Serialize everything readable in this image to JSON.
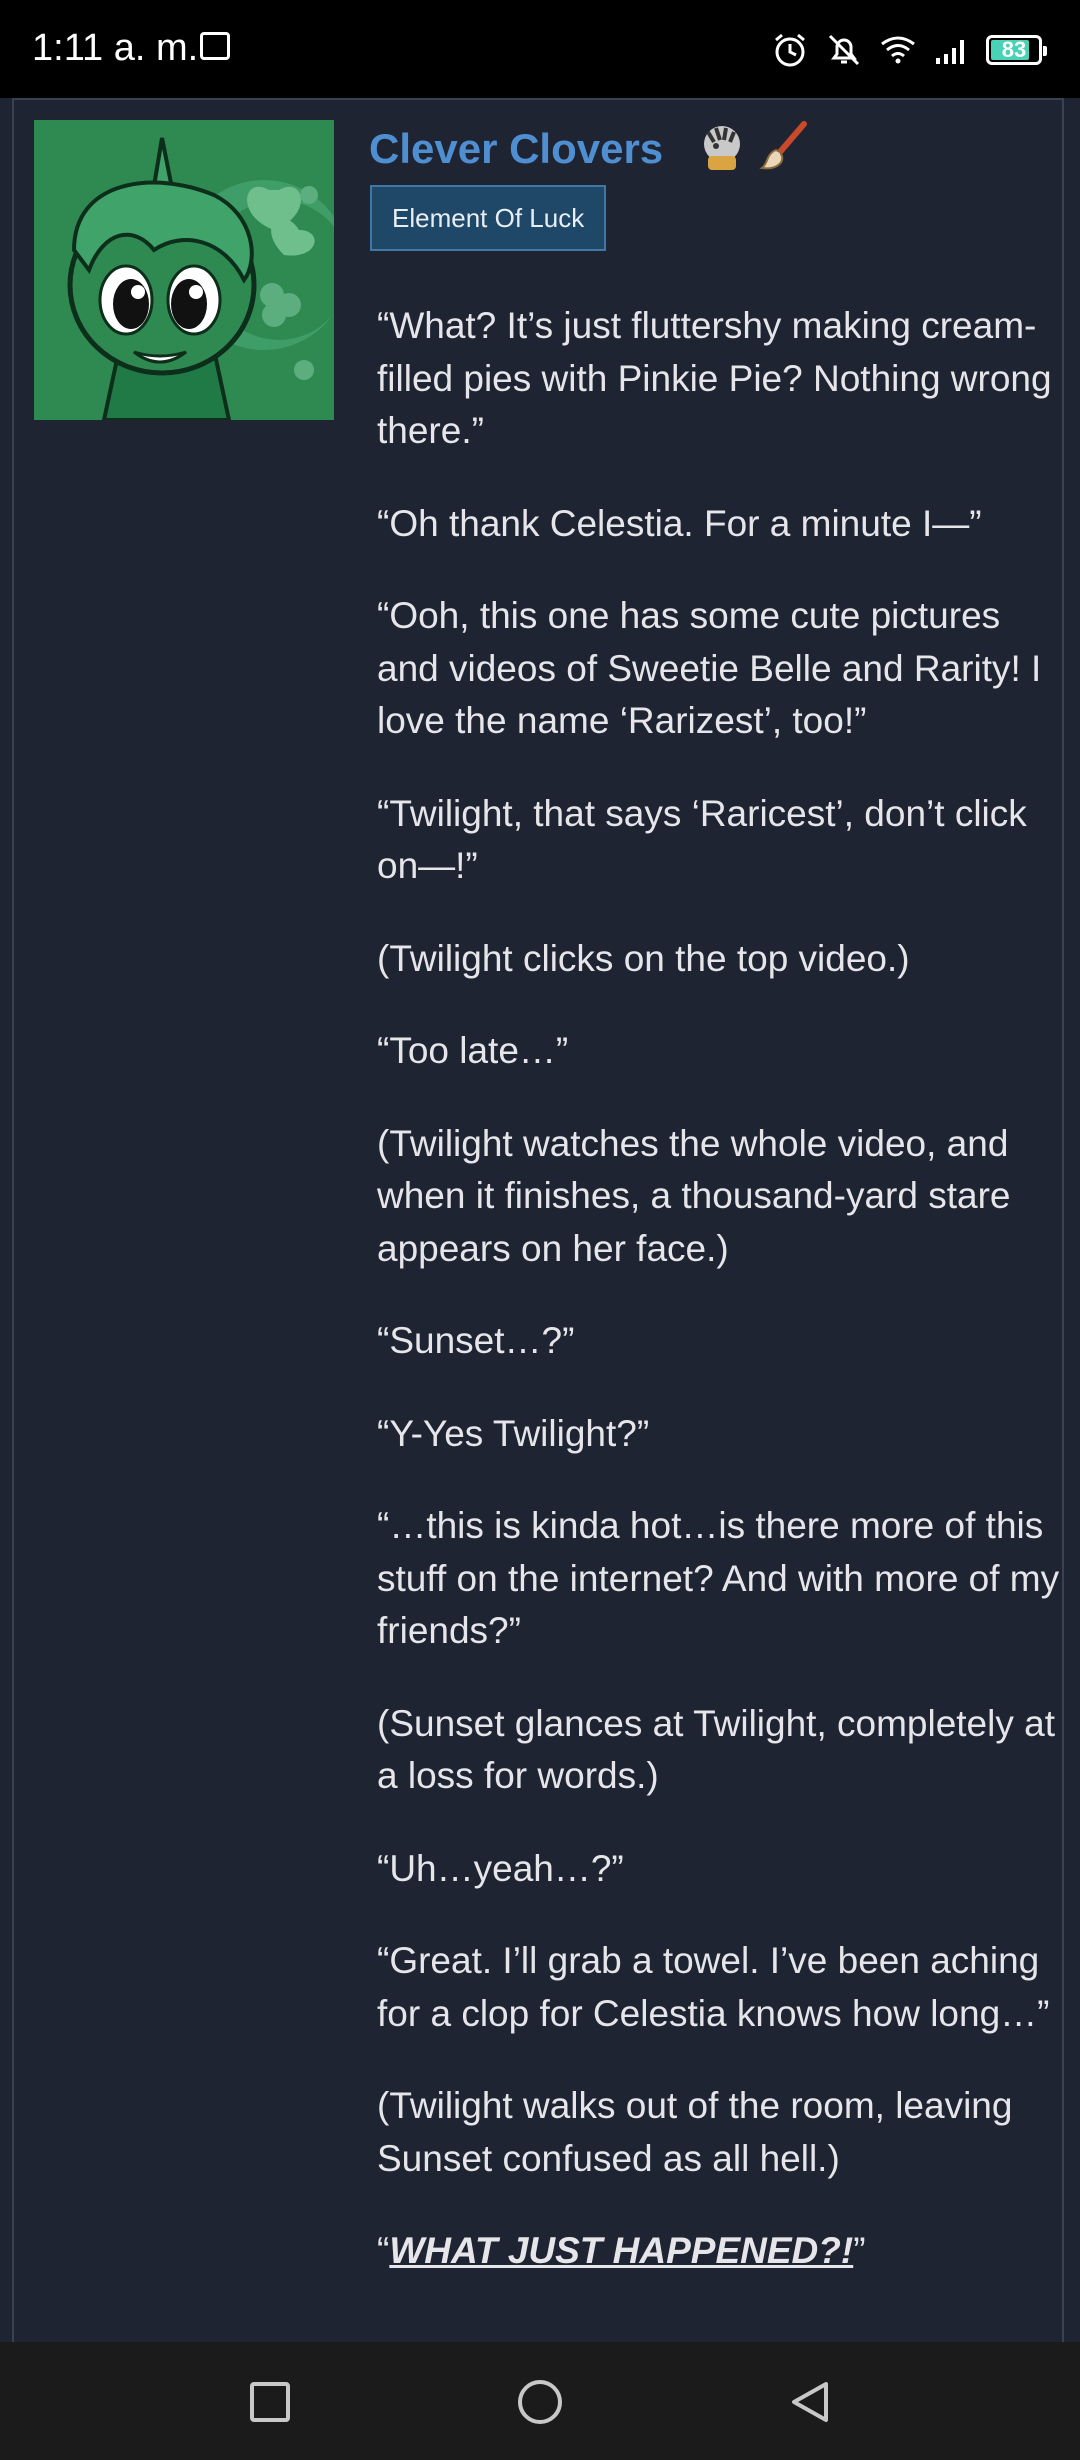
{
  "status_bar": {
    "time": "1:11 a. m.",
    "battery": "83",
    "battery_level": 0.83,
    "icons": [
      "gallery-icon",
      "alarm-icon",
      "bell-off-icon",
      "wifi-icon",
      "signal-icon",
      "battery-icon"
    ]
  },
  "post": {
    "author": "Clever Clovers",
    "rank_badge": "Element Of Luck",
    "colors": {
      "author": "#4f8fd1",
      "badge_bg": "#1f4767",
      "avatar_bg": "#2f8a52"
    },
    "paragraphs": [
      "“What? It’s just fluttershy making cream-filled pies with Pinkie Pie? Nothing wrong there.”",
      "“Oh thank Celestia. For a minute I—”",
      "“Ooh, this one has some cute pictures and videos of Sweetie Belle and Rarity! I love the name ‘Rarizest’, too!”",
      "“Twilight, that says ‘Raricest’, don’t click on—!”",
      "(Twilight clicks on the top video.)",
      "“Too late…”",
      "(Twilight watches the whole video, and when it finishes, a thousand-yard stare appears on her face.)",
      "“Sunset…?”",
      "“Y-Yes Twilight?”",
      "“…this is kinda hot…is there more of this stuff on the internet? And with more of my friends?”",
      "(Sunset glances at Twilight, completely at a loss for words.)",
      "“Uh…yeah…?”",
      "“Great. I’ll grab a towel. I’ve been aching for a clop for Celestia knows how long…”",
      "(Twilight walks out of the room, leaving Sunset confused as all hell.)"
    ],
    "last_line": {
      "open": "“",
      "shout": "WHAT JUST HAPPENED?!",
      "close": "”"
    }
  },
  "nav_bar": {
    "buttons": [
      "recents-button",
      "home-button",
      "back-button"
    ]
  }
}
